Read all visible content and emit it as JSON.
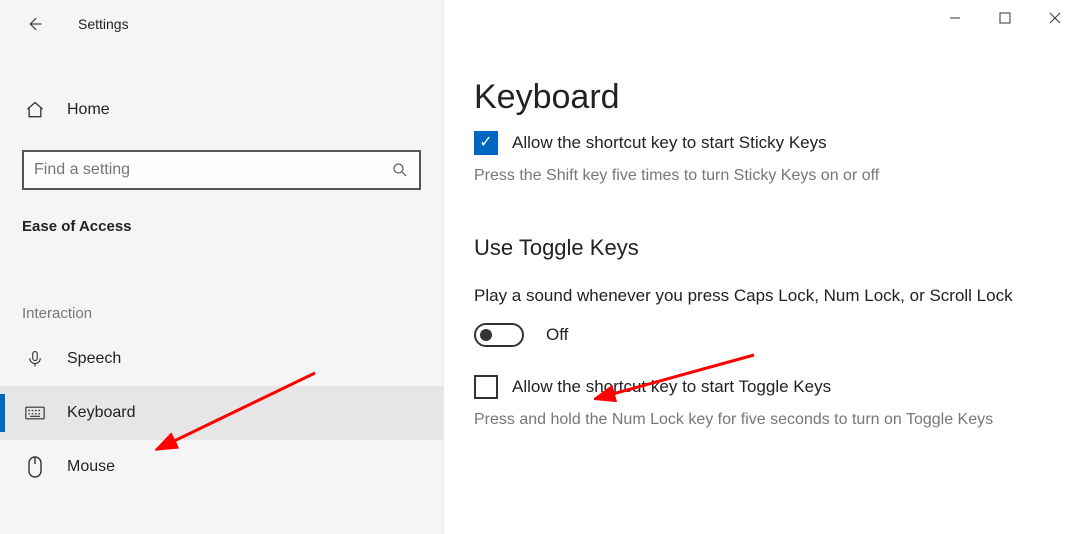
{
  "titlebar": {
    "title": "Settings"
  },
  "sidebar": {
    "home_label": "Home",
    "search_placeholder": "Find a setting",
    "section_title": "Ease of Access",
    "group_title": "Interaction",
    "items": [
      {
        "label": "Speech"
      },
      {
        "label": "Keyboard"
      },
      {
        "label": "Mouse"
      }
    ]
  },
  "main": {
    "heading": "Keyboard",
    "sticky_check_label": "Allow the shortcut key to start Sticky Keys",
    "sticky_help": "Press the Shift key five times to turn Sticky Keys on or off",
    "toggle_section_title": "Use Toggle Keys",
    "toggle_desc": "Play a sound whenever you press Caps Lock, Num Lock, or Scroll Lock",
    "toggle_state": "Off",
    "toggle_check_label": "Allow the shortcut key to start Toggle Keys",
    "toggle_help": "Press and hold the Num Lock key for five seconds to turn on Toggle Keys"
  }
}
